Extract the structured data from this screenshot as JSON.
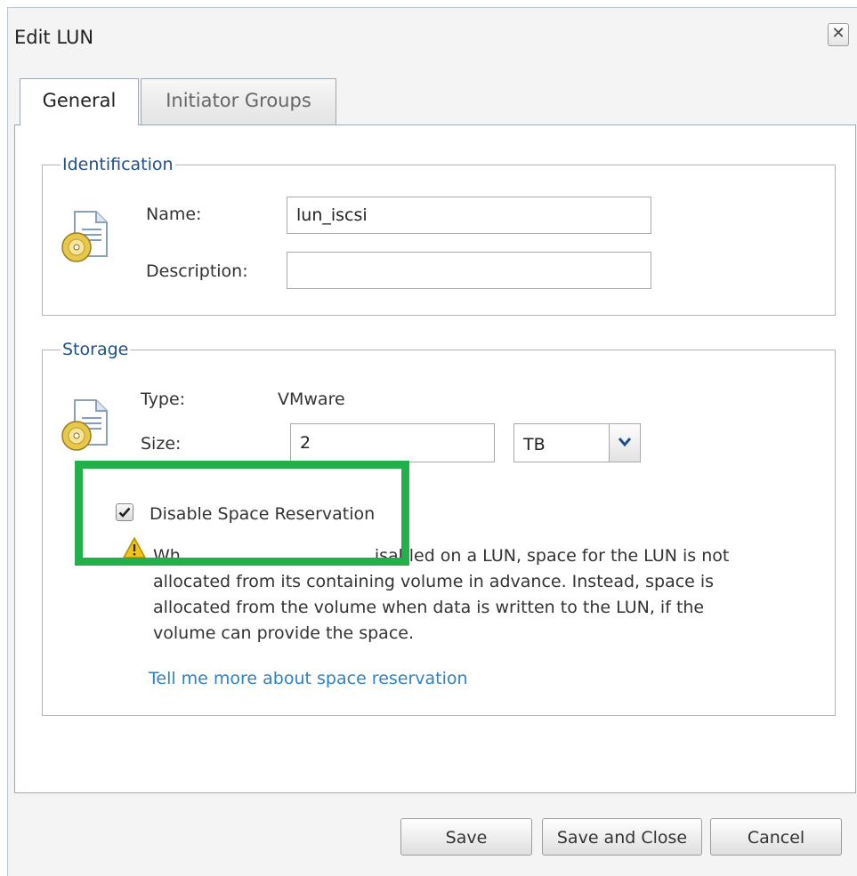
{
  "dialog": {
    "title": "Edit LUN",
    "close_glyph": "✕"
  },
  "tabs": [
    {
      "label": "General",
      "active": true
    },
    {
      "label": "Initiator Groups",
      "active": false
    }
  ],
  "identification": {
    "legend": "Identification",
    "name_label": "Name:",
    "name_value": "lun_iscsi",
    "description_label": "Description:",
    "description_value": "",
    "icon": "lun-document-icon"
  },
  "storage": {
    "legend": "Storage",
    "type_label": "Type:",
    "type_value": "VMware",
    "size_label": "Size:",
    "size_value": "2",
    "size_unit": "TB",
    "icon": "lun-document-icon",
    "checkbox_label": "Disable Space Reservation",
    "checkbox_checked": true,
    "warning_icon": "warning-icon",
    "warning_visible_lines": [
      "Wh",
      "isabled on a LUN, space for the LUN is not",
      "allocated from its containing volume in advance. Instead, space is",
      "allocated from the volume when data is written to the LUN, if the",
      "volume can provide the space."
    ],
    "link": "Tell me more about space reservation"
  },
  "buttons": {
    "save": "Save",
    "save_close": "Save and Close",
    "cancel": "Cancel"
  },
  "colors": {
    "highlight": "#22b04b",
    "legend": "#1f4f8c",
    "link": "#2d82c6"
  }
}
